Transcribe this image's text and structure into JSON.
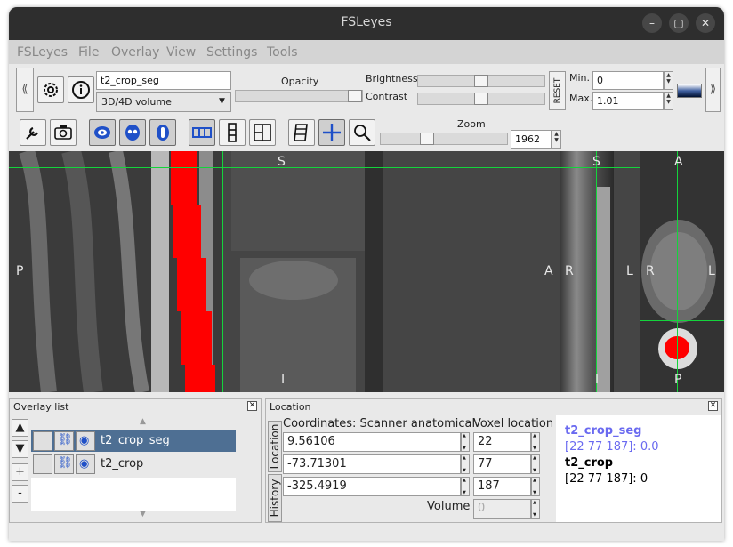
{
  "window": {
    "title": "FSLeyes"
  },
  "menu": [
    "FSLeyes",
    "File",
    "Overlay",
    "View",
    "Settings",
    "Tools"
  ],
  "overlay_toolbar": {
    "name_value": "t2_crop_seg",
    "type_value": "3D/4D volume",
    "opacity_label": "Opacity",
    "brightness_label": "Brightness",
    "contrast_label": "Contrast",
    "reset_label": "RESET",
    "min_label": "Min.",
    "min_value": "0",
    "max_label": "Max.",
    "max_value": "1.01",
    "opacity": 1.0,
    "brightness": 0.5,
    "contrast": 0.5
  },
  "ortho_toolbar": {
    "zoom_label": "Zoom",
    "zoom_value": "1962"
  },
  "canvas": {
    "orientation": {
      "sagittal": {
        "top": "S",
        "left": "P",
        "right": "A",
        "bottom": "I"
      },
      "coronal": {
        "top": "S",
        "left": "R",
        "right": "L",
        "bottom": "I"
      },
      "axial": {
        "top": "A",
        "left": "R",
        "right": "L",
        "bottom": "P"
      }
    },
    "colors": {
      "crosshair": "#14d43c",
      "segmentation": "#ff0000"
    }
  },
  "overlay_list": {
    "title": "Overlay list",
    "items": [
      {
        "name": "t2_crop_seg",
        "selected": true
      },
      {
        "name": "t2_crop",
        "selected": false
      }
    ],
    "add": "+",
    "remove": "-"
  },
  "location": {
    "title": "Location",
    "tabs": [
      "Location",
      "History"
    ],
    "coords_header": "Coordinates: Scanner anatomical",
    "voxel_header": "Voxel location",
    "coords": [
      "9.56106",
      "-73.71301",
      "-325.4919"
    ],
    "voxels": [
      "22",
      "77",
      "187"
    ],
    "volume_label": "Volume",
    "volume_value": "0",
    "info": [
      {
        "name": "t2_crop_seg",
        "value": "[22 77 187]: 0.0",
        "color": "#6a6af0"
      },
      {
        "name": "t2_crop",
        "value": "[22 77 187]: 0",
        "color": "#000000"
      }
    ]
  }
}
